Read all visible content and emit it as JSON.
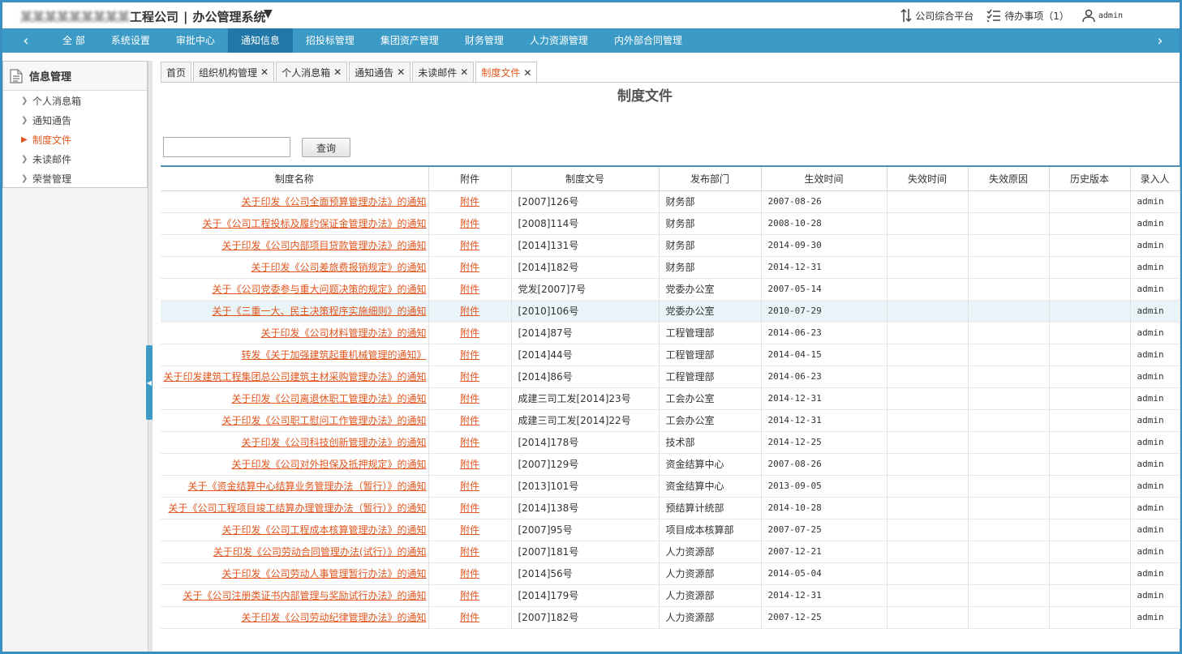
{
  "header": {
    "company_blurred": "某某某某某某某某某",
    "company_suffix": "工程公司",
    "separator": "|",
    "system_name": "办公管理系统",
    "platform_label": "公司综合平台",
    "todo_label": "待办事项（1）",
    "user_label": "admin"
  },
  "nav": {
    "items": [
      "全 部",
      "系统设置",
      "审批中心",
      "通知信息",
      "招投标管理",
      "集团资产管理",
      "财务管理",
      "人力资源管理",
      "内外部合同管理"
    ],
    "active_index": 3
  },
  "sidebar": {
    "title": "信息管理",
    "items": [
      "个人消息箱",
      "通知通告",
      "制度文件",
      "未读邮件",
      "荣誉管理"
    ],
    "active_index": 2
  },
  "tabs": [
    {
      "label": "首页",
      "closable": false
    },
    {
      "label": "组织机构管理",
      "closable": true
    },
    {
      "label": "个人消息箱",
      "closable": true
    },
    {
      "label": "通知通告",
      "closable": true
    },
    {
      "label": "未读邮件",
      "closable": true
    },
    {
      "label": "制度文件",
      "closable": true,
      "active": true
    }
  ],
  "page": {
    "title": "制度文件",
    "search_value": "",
    "search_button": "查询"
  },
  "table": {
    "columns": [
      "制度名称",
      "附件",
      "制度文号",
      "发布部门",
      "生效时间",
      "失效时间",
      "失效原因",
      "历史版本",
      "录入人"
    ],
    "attachment_label": "附件",
    "highlight_row": 5,
    "rows": [
      {
        "name": "关于印发《公司全面预算管理办法》的通知",
        "doc_no": "[2007]126号",
        "dept": "财务部",
        "effective": "2007-08-26",
        "user": "admin"
      },
      {
        "name": "关于《公司工程投标及履约保证金管理办法》的通知",
        "doc_no": "[2008]114号",
        "dept": "财务部",
        "effective": "2008-10-28",
        "user": "admin"
      },
      {
        "name": "关于印发《公司内部项目贷款管理办法》的通知",
        "doc_no": "[2014]131号",
        "dept": "财务部",
        "effective": "2014-09-30",
        "user": "admin"
      },
      {
        "name": "关于印发《公司差旅费报销规定》的通知",
        "doc_no": "[2014]182号",
        "dept": "财务部",
        "effective": "2014-12-31",
        "user": "admin"
      },
      {
        "name": "关于《公司党委参与重大问题决策的规定》的通知",
        "doc_no": "党发[2007]7号",
        "dept": "党委办公室",
        "effective": "2007-05-14",
        "user": "admin"
      },
      {
        "name": "关于《三重一大、民主决策程序实施细则》的通知",
        "doc_no": "[2010]106号",
        "dept": "党委办公室",
        "effective": "2010-07-29",
        "user": "admin"
      },
      {
        "name": "关于印发《公司材料管理办法》的通知",
        "doc_no": "[2014]87号",
        "dept": "工程管理部",
        "effective": "2014-06-23",
        "user": "admin"
      },
      {
        "name": "转发《关于加强建筑起重机械管理的通知》",
        "doc_no": "[2014]44号",
        "dept": "工程管理部",
        "effective": "2014-04-15",
        "user": "admin"
      },
      {
        "name": "关于印发建筑工程集团总公司建筑主材采购管理办法》的通知",
        "doc_no": "[2014]86号",
        "dept": "工程管理部",
        "effective": "2014-06-23",
        "user": "admin"
      },
      {
        "name": "关于印发《公司离退休职工管理办法》的通知",
        "doc_no": "成建三司工发[2014]23号",
        "dept": "工会办公室",
        "effective": "2014-12-31",
        "user": "admin"
      },
      {
        "name": "关于印发《公司职工慰问工作管理办法》的通知",
        "doc_no": "成建三司工发[2014]22号",
        "dept": "工会办公室",
        "effective": "2014-12-31",
        "user": "admin"
      },
      {
        "name": "关于印发《公司科技创新管理办法》的通知",
        "doc_no": "[2014]178号",
        "dept": "技术部",
        "effective": "2014-12-25",
        "user": "admin"
      },
      {
        "name": "关于印发《公司对外担保及抵押规定》的通知",
        "doc_no": "[2007]129号",
        "dept": "资金结算中心",
        "effective": "2007-08-26",
        "user": "admin"
      },
      {
        "name": "关于《资金结算中心结算业务管理办法（暂行）》的通知",
        "doc_no": "[2013]101号",
        "dept": "资金结算中心",
        "effective": "2013-09-05",
        "user": "admin"
      },
      {
        "name": "关于《公司工程项目竣工结算办理管理办法（暂行）》的通知",
        "doc_no": "[2014]138号",
        "dept": "预结算计统部",
        "effective": "2014-10-28",
        "user": "admin"
      },
      {
        "name": "关于印发《公司工程成本核算管理办法》的通知",
        "doc_no": "[2007]95号",
        "dept": "项目成本核算部",
        "effective": "2007-07-25",
        "user": "admin"
      },
      {
        "name": "关于印发《公司劳动合同管理办法(试行）》的通知",
        "doc_no": "[2007]181号",
        "dept": "人力资源部",
        "effective": "2007-12-21",
        "user": "admin"
      },
      {
        "name": "关于印发《公司劳动人事管理暂行办法》的通知",
        "doc_no": "[2014]56号",
        "dept": "人力资源部",
        "effective": "2014-05-04",
        "user": "admin"
      },
      {
        "name": "关于《公司注册类证书内部管理与奖励试行办法》的通知",
        "doc_no": "[2014]179号",
        "dept": "人力资源部",
        "effective": "2014-12-31",
        "user": "admin"
      },
      {
        "name": "关于印发《公司劳动纪律管理办法》的通知",
        "doc_no": "[2007]182号",
        "dept": "人力资源部",
        "effective": "2007-12-25",
        "user": "admin"
      }
    ]
  },
  "colors": {
    "nav_bg": "#3c9bc6",
    "nav_active": "#2178a8",
    "link": "#e0561f",
    "frame": "#3b8ec0"
  }
}
